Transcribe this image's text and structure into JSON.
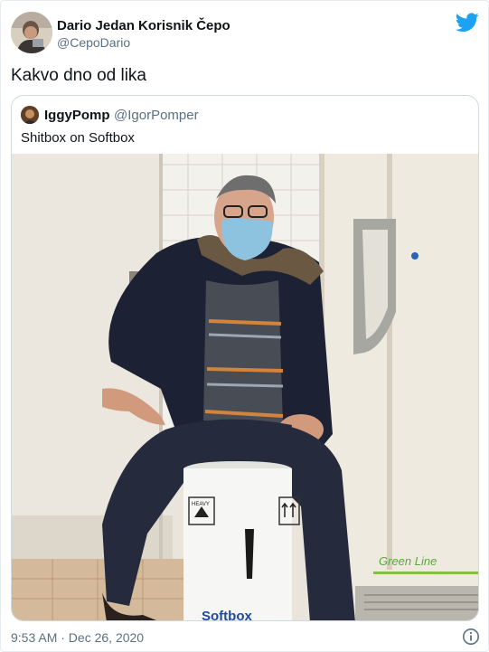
{
  "tweet": {
    "author_name": "Dario Jedan Korisnik Čepo",
    "author_handle": "@CepoDario",
    "text": "Kakvo dno od lika",
    "timestamp": "9:53 AM · Dec 26, 2020"
  },
  "quoted_tweet": {
    "author_name": "IggyPomp",
    "author_handle": "@IgorPomper",
    "text": "Shitbox on Softbox",
    "photo": {
      "box_brand": "Softbox",
      "box_heavy_label": "HEAVY",
      "freezer_label": "Green Line"
    }
  },
  "icons": {
    "twitter": "twitter-bird-icon",
    "info": "info-icon"
  },
  "colors": {
    "twitter_blue": "#1da1f2",
    "secondary_text": "#5b7083",
    "border": "#cfd9de"
  }
}
